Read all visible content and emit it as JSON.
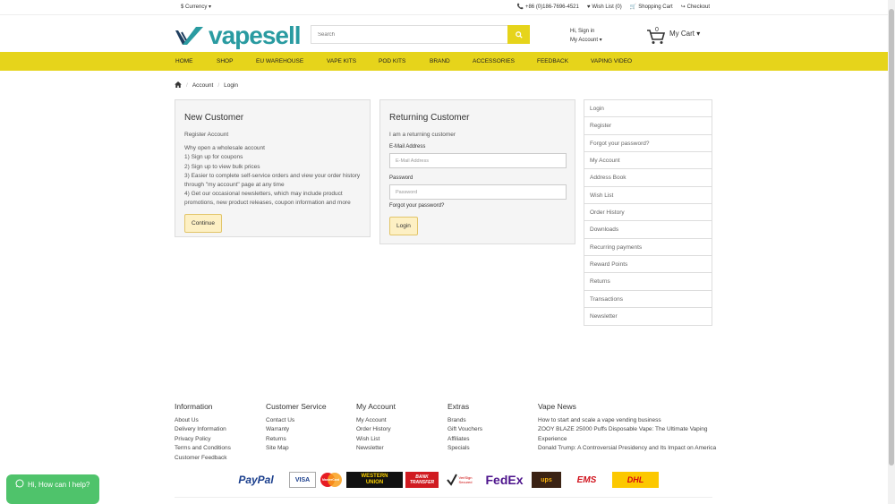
{
  "topbar": {
    "currency": "$ Currency",
    "phone": "+86 (0)186-7696-4521",
    "wishlist": "Wish List (0)",
    "cart": "Shopping Cart",
    "checkout": "Checkout"
  },
  "header": {
    "logo_text": "vapesell",
    "search_placeholder": "Search",
    "account_line1": "Hi, Sign in",
    "account_line2": "My Account",
    "cart_count": "0",
    "cart_label": "My Cart"
  },
  "nav": [
    "HOME",
    "SHOP",
    "EU WAREHOUSE",
    "VAPE KITS",
    "POD KITS",
    "BRAND",
    "ACCESSORIES",
    "FEEDBACK",
    "VAPING VIDEO"
  ],
  "breadcrumb": [
    "Account",
    "Login"
  ],
  "new_customer": {
    "title": "New Customer",
    "subtitle": "Register Account",
    "lines": [
      "Why open a wholesale account",
      "1) Sign up for coupons",
      "2) Sign up to view bulk prices",
      "3) Easier to complete self-service orders and view your order history through \"my account\" page at any time",
      "4) Get our occasional newsletters, which may include product promotions, new product releases, coupon information and more"
    ],
    "button": "Continue"
  },
  "returning": {
    "title": "Returning Customer",
    "subtitle": "I am a returning customer",
    "email_label": "E-Mail Address",
    "email_placeholder": "E-Mail Address",
    "password_label": "Password",
    "password_placeholder": "Password",
    "forgot": "Forgot your password?",
    "button": "Login"
  },
  "sidebar": [
    "Login",
    "Register",
    "Forgot your password?",
    "My Account",
    "Address Book",
    "Wish List",
    "Order History",
    "Downloads",
    "Recurring payments",
    "Reward Points",
    "Returns",
    "Transactions",
    "Newsletter"
  ],
  "footer": {
    "information": {
      "title": "Information",
      "items": [
        "About Us",
        "Delivery Information",
        "Privacy Policy",
        "Terms and Conditions",
        "Customer Feedback"
      ]
    },
    "service": {
      "title": "Customer Service",
      "items": [
        "Contact Us",
        "Warranty",
        "Returns",
        "Site Map"
      ]
    },
    "account": {
      "title": "My Account",
      "items": [
        "My Account",
        "Order History",
        "Wish List",
        "Newsletter"
      ]
    },
    "extras": {
      "title": "Extras",
      "items": [
        "Brands",
        "Gift Vouchers",
        "Affiliates",
        "Specials"
      ]
    },
    "news": {
      "title": "Vape News",
      "items": [
        "How to start and scale a vape vending business",
        "ZOOY BLAZE 25000 Puffs Disposable Vape: The Ultimate Vaping Experience",
        "Donald Trump: A Controversial Presidency and Its Impact on America"
      ]
    }
  },
  "payments": {
    "paypal": "PayPal",
    "visa": "VISA",
    "mastercard": "MasterCard",
    "wu_line1": "WESTERN",
    "wu_line2": "UNION",
    "bank_line1": "BANK",
    "bank_line2": "TRANSFER",
    "verisign_line1": "VeriSign",
    "verisign_line2": "Secured",
    "fedex": "FedEx",
    "ups": "ups",
    "ems": "EMS",
    "dhl": "DHL"
  },
  "chat": {
    "label": "Hi, How can I help?"
  }
}
